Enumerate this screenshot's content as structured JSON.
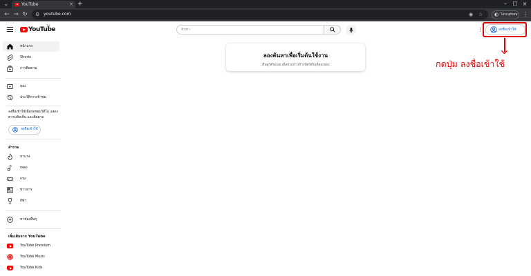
{
  "browser": {
    "tab_title": "YouTube",
    "tab_close": "×",
    "new_tab": "+",
    "window_controls": [
      "–",
      "☐",
      "×"
    ],
    "url": "youtube.com",
    "profile_label": "ไม่ระบุตัวตน",
    "icons": [
      "back-icon",
      "forward-icon",
      "reload-icon",
      "site-settings-icon",
      "eye-off-icon",
      "star-icon",
      "incognito-icon",
      "kebab-menu-icon"
    ]
  },
  "header": {
    "logo_text": "YouTube",
    "logo_superscript": "TH",
    "search_placeholder": "ค้นหา",
    "signin_label": "ลงชื่อเข้าใช้"
  },
  "annotation": {
    "callout_text": "กดปุ่ม ลงชื่อเข้าใช้",
    "color": "#e00000"
  },
  "sidebar": {
    "primary": [
      {
        "label": "หน้าแรก",
        "icon": "home-icon",
        "active": true
      },
      {
        "label": "Shorts",
        "icon": "shorts-icon",
        "active": false
      },
      {
        "label": "การติดตาม",
        "icon": "subscriptions-icon",
        "active": false
      }
    ],
    "you": [
      {
        "label": "คุณ",
        "icon": "you-icon"
      },
      {
        "label": "ประวัติการเข้าชม",
        "icon": "history-icon"
      }
    ],
    "signin_note": "ลงชื่อเข้าใช้เพื่อกดชอบวิดีโอ แสดงความคิดเห็น และติดตาม",
    "signin_label": "ลงชื่อเข้าใช้",
    "explore_title": "สำรวจ",
    "explore": [
      {
        "label": "มาแรง",
        "icon": "trending-icon"
      },
      {
        "label": "เพลง",
        "icon": "music-icon"
      },
      {
        "label": "เกม",
        "icon": "gaming-icon"
      },
      {
        "label": "ข่าวสาร",
        "icon": "news-icon"
      },
      {
        "label": "กีฬา",
        "icon": "sports-icon"
      }
    ],
    "browse_channels": {
      "label": "หาช่องอื่นๆ",
      "icon": "add-circle-icon"
    },
    "more_title": "เพิ่มเติมจาก YouTube",
    "more": [
      {
        "label": "YouTube Premium",
        "icon": "youtube-premium-icon"
      },
      {
        "label": "YouTube Music",
        "icon": "youtube-music-icon"
      },
      {
        "label": "YouTube Kids",
        "icon": "youtube-kids-icon"
      }
    ]
  },
  "main": {
    "prompt_title": "ลองค้นหาเพื่อเริ่มต้นใช้งาน",
    "prompt_subtitle": "เริ่มดูวิดีโอเลย เพื่อช่วยเราสร้างฟีดวิดีโอที่คุณชอบ"
  },
  "colors": {
    "youtube_red": "#ff0000",
    "link_blue": "#065fd4",
    "chrome_dark": "#202124",
    "chrome_bar": "#35363a"
  }
}
